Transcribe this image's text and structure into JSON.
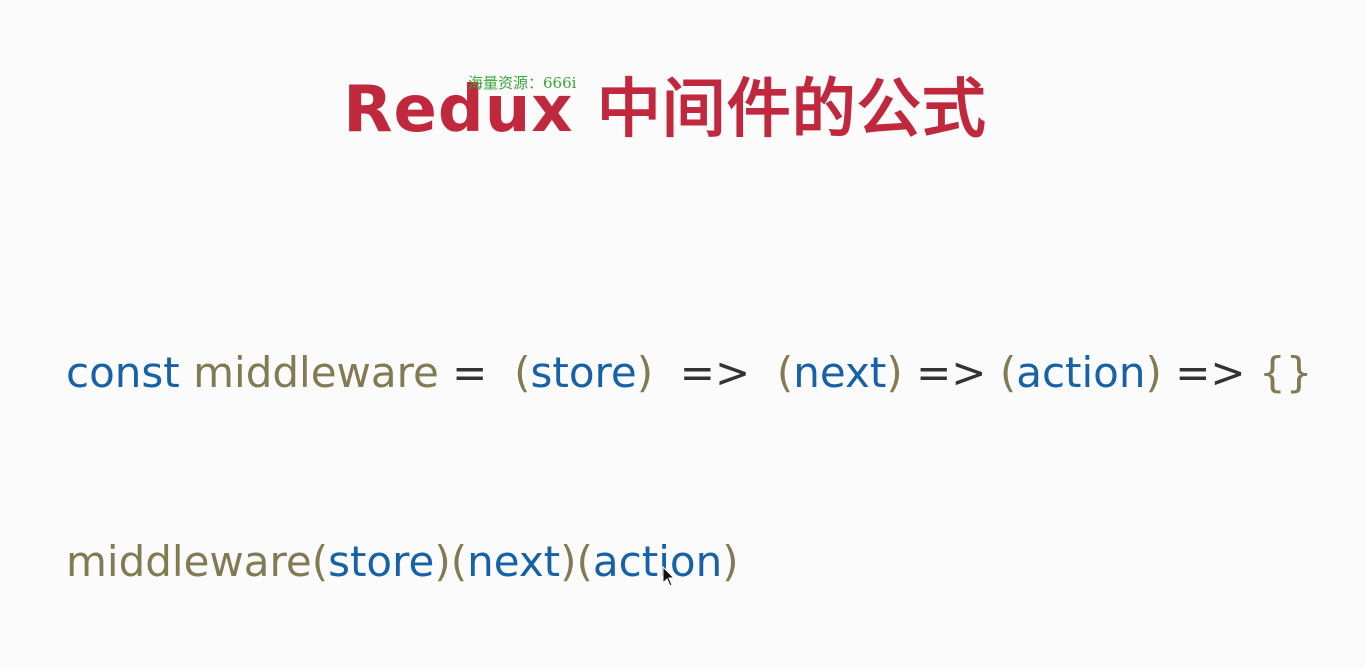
{
  "slide": {
    "title": "Redux 中间件的公式",
    "watermark": "海量资源：666i"
  },
  "line1": {
    "const": "const",
    "name": "middleware",
    "equals": " = ",
    "open1": " (",
    "param1": "store",
    "close1": ")",
    "arrow1": "  =>  ",
    "open2": "(",
    "param2": "next",
    "close2": ")",
    "arrow2": " => ",
    "open3": "(",
    "param3": "action",
    "close3": ")",
    "arrow3": " => ",
    "body": "{}"
  },
  "line2": {
    "name": "middleware",
    "open1": "(",
    "arg1": "store",
    "close1": ")",
    "open2": "(",
    "arg2": "next",
    "close2": ")",
    "open3": "(",
    "arg3": "action",
    "close3": ")"
  },
  "colors": {
    "title": "#c0283e",
    "keyword": "#1661a8",
    "function": "#827a52",
    "watermark": "#3aa53a"
  },
  "cursor": {
    "icon": "mouse-pointer-icon"
  }
}
